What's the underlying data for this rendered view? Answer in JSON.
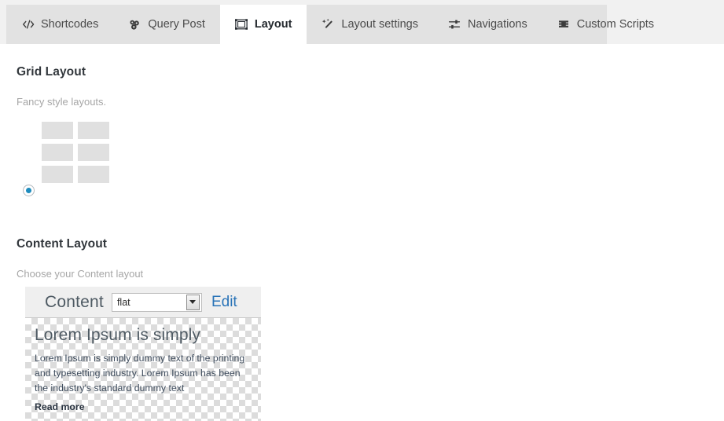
{
  "tabs": [
    {
      "label": "Shortcodes",
      "icon": "code-brackets-icon",
      "active": false
    },
    {
      "label": "Query Post",
      "icon": "network-nodes-icon",
      "active": false
    },
    {
      "label": "Layout",
      "icon": "layout-frame-icon",
      "active": true
    },
    {
      "label": "Layout settings",
      "icon": "magic-wand-icon",
      "active": false
    },
    {
      "label": "Navigations",
      "icon": "sliders-icon",
      "active": false
    },
    {
      "label": "Custom Scripts",
      "icon": "layers-icon",
      "active": false
    }
  ],
  "grid_section": {
    "title": "Grid Layout",
    "description": "Fancy style layouts.",
    "thumbnail": {
      "columns": 2,
      "rows": 3,
      "cell_count": 6,
      "cell_color": "#e0e0e0"
    },
    "radio": {
      "name": "grid-layout-choice",
      "selected": true,
      "accent_color": "#1e8cbe"
    }
  },
  "content_section": {
    "title": "Content Layout",
    "description": "Choose your Content layout",
    "widget": {
      "title": "Content",
      "select": {
        "value": "flat",
        "options": [
          "flat"
        ]
      },
      "edit_label": "Edit",
      "edit_color": "#2a74b8",
      "preview": {
        "heading": "Lorem Ipsum is simply",
        "paragraph": "Lorem Ipsum is simply dummy text of the printing and typesetting industry. Lorem Ipsum has been the industry's standard dummy text",
        "read_more_label": "Read more",
        "background": "transparency-checkerboard"
      }
    }
  }
}
